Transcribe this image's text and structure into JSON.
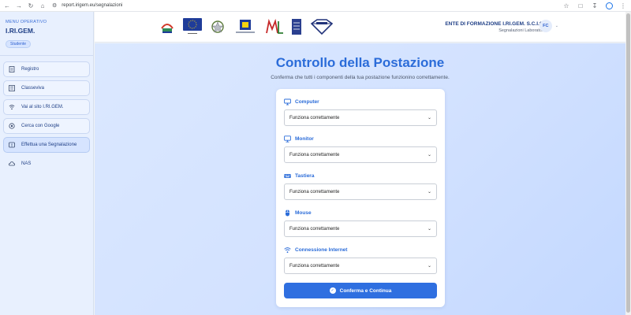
{
  "browser": {
    "url": "report.irigem.eu/segnalazioni"
  },
  "sidebar": {
    "menu_label": "MENU OPERATIVO",
    "org": "I.RI.GEM.",
    "role": "Studente",
    "items": [
      {
        "label": "Registro",
        "icon": "register-icon"
      },
      {
        "label": "Classeviva",
        "icon": "classeviva-icon"
      },
      {
        "label": "Vai al sito I.RI.GEM.",
        "icon": "wifi-icon"
      },
      {
        "label": "Cerca con Google",
        "icon": "google-icon"
      },
      {
        "label": "Effettua una Segnalazione",
        "icon": "report-icon",
        "active": true
      },
      {
        "label": "NAS",
        "icon": "nas-icon"
      }
    ]
  },
  "header": {
    "org_name": "ENTE DI FORMAZIONE I.RI.GEM. S.C.I.S.",
    "org_sub": "Segnalazioni Laboratori",
    "user_initials": "FC"
  },
  "main": {
    "title": "Controllo della Postazione",
    "subtitle": "Conferma che tutti i componenti della tua postazione funzionino correttamente.",
    "sections": [
      {
        "label": "Computer",
        "value": "Funziona correttamente",
        "icon": "monitor-icon"
      },
      {
        "label": "Monitor",
        "value": "Funziona correttamente",
        "icon": "display-icon"
      },
      {
        "label": "Tastiera",
        "value": "Funziona correttamente",
        "icon": "keyboard-icon"
      },
      {
        "label": "Mouse",
        "value": "Funziona correttamente",
        "icon": "mouse-icon"
      },
      {
        "label": "Connessione Internet",
        "value": "Funziona correttamente",
        "icon": "wifi-icon"
      }
    ],
    "confirm_label": "Conferma e Continua"
  },
  "colors": {
    "accent": "#2b6cd9",
    "button": "#2f6fe0",
    "sidebar_bg": "#e8f0fe"
  }
}
